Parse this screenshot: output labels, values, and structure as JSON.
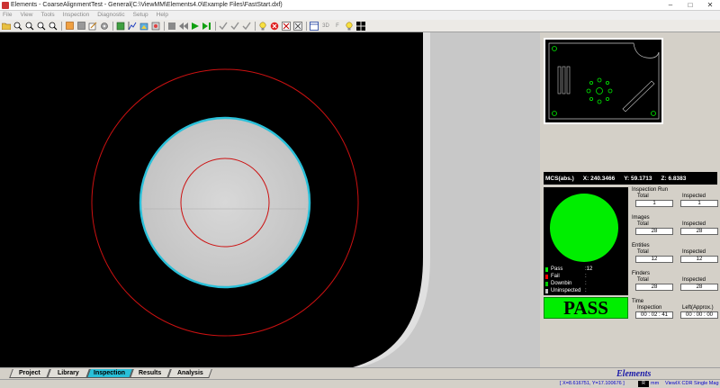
{
  "window": {
    "title": "Elements - CoarseAlignmentTest - General(C:\\ViewMM\\Elements4.0\\Example Files\\FastStart.dxf)",
    "minimize": "–",
    "maximize": "□",
    "close": "✕"
  },
  "menu": [
    "File",
    "View",
    "Tools",
    "Inspection",
    "Diagnostic",
    "Setup",
    "Help"
  ],
  "toolbar": {
    "icon_3d": "3D",
    "icon_f": "F"
  },
  "colors": {
    "pass_green": "#00ee00",
    "fail_red": "#ff0000",
    "downbin_green": "#00cc00",
    "uninspected_gray": "#c8c8c8",
    "active_tab": "#29c0d9",
    "part_edge": "#29c0d9",
    "ring_red": "#cc1111"
  },
  "coordinates": {
    "label": "MCS(abs.)",
    "x": "X: 240.3466",
    "y": "Y: 59.1713",
    "z": "Z: 6.8383"
  },
  "status_legend": [
    {
      "label": "Pass",
      "value": ":12",
      "color": "#00ee00"
    },
    {
      "label": "Fail",
      "value": ":",
      "color": "#ff0000"
    },
    {
      "label": "Downbin",
      "value": ":",
      "color": "#00cc00"
    },
    {
      "label": "Uninspected",
      "value": ":",
      "color": "#c8c8c8"
    }
  ],
  "result": "PASS",
  "stats": {
    "inspection_run": {
      "title": "Inspection Run",
      "left_label": "Total",
      "left_value": "1",
      "right_label": "Inspected",
      "right_value": "1"
    },
    "images": {
      "title": "Images",
      "left_label": "Total",
      "left_value": "28",
      "right_label": "Inspected",
      "right_value": "28"
    },
    "entities": {
      "title": "Entities",
      "left_label": "Total",
      "left_value": "12",
      "right_label": "Inspected",
      "right_value": "12"
    },
    "finders": {
      "title": "Finders",
      "left_label": "Total",
      "left_value": "28",
      "right_label": "Inspected",
      "right_value": "28"
    },
    "time": {
      "title": "Time",
      "left_label": "Inspection",
      "left_value": "00 : 02 : 41",
      "right_label": "Left(Approx.)",
      "right_value": "00 : 00 : 00"
    }
  },
  "tabs": [
    "Project",
    "Library",
    "Inspection",
    "Results",
    "Analysis"
  ],
  "active_tab": "Inspection",
  "brand": "Elements",
  "statusbar": {
    "coords": "[ X=8.616751, Y=17.100676 ]",
    "unit_badge": "R",
    "unit": "mm",
    "mode": "ViewIX CDR Single Mag"
  }
}
